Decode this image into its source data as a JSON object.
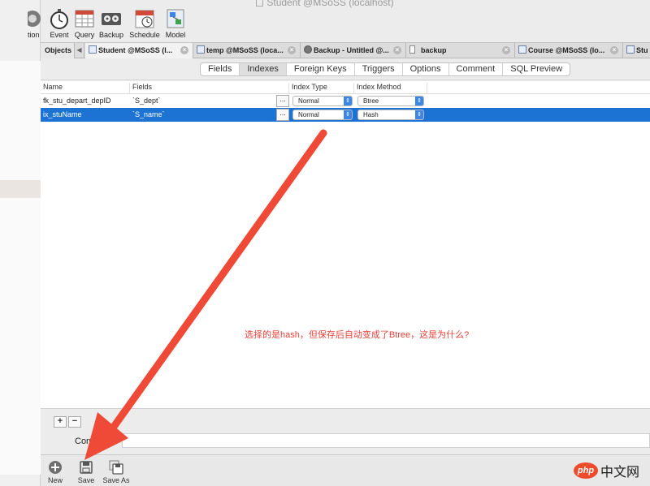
{
  "window": {
    "title": "Student @MSoSS (localhost)"
  },
  "toolbar": {
    "items": [
      {
        "label": "tion",
        "icon": "function-icon"
      },
      {
        "label": "Event",
        "icon": "stopwatch-icon"
      },
      {
        "label": "Query",
        "icon": "table-icon"
      },
      {
        "label": "Backup",
        "icon": "tape-icon"
      },
      {
        "label": "Schedule",
        "icon": "calendar-icon"
      },
      {
        "label": "Model",
        "icon": "model-icon"
      }
    ]
  },
  "tabs": {
    "objects": "Objects",
    "items": [
      {
        "label": "Student @MSoSS (l..."
      },
      {
        "label": "temp @MSoSS (loca..."
      },
      {
        "label": "Backup - Untitled @..."
      },
      {
        "label": "backup"
      },
      {
        "label": "Course @MSoSS (lo..."
      },
      {
        "label": "Stu"
      }
    ]
  },
  "subtabs": {
    "items": [
      "Fields",
      "Indexes",
      "Foreign Keys",
      "Triggers",
      "Options",
      "Comment",
      "SQL Preview"
    ],
    "active": "Indexes"
  },
  "grid": {
    "columns": [
      "Name",
      "Fields",
      "Index Type",
      "Index Method"
    ],
    "rows": [
      {
        "name": "fk_stu_depart_depID",
        "fields": "`S_dept`",
        "type": "Normal",
        "method": "Btree",
        "dots": "...",
        "selected": false
      },
      {
        "name": "ix_stuName",
        "fields": "`S_name`",
        "type": "Normal",
        "method": "Hash",
        "dots": "...",
        "selected": true
      }
    ]
  },
  "annotation": {
    "text": "选择的是hash，但保存后自动变成了Btree，这是为什么?",
    "color": "#e8413a"
  },
  "bottom": {
    "plus": "+",
    "minus": "−",
    "comment_label": "Comm",
    "buttons": [
      {
        "label": "New",
        "icon": "plus-circle-icon"
      },
      {
        "label": "Save",
        "icon": "save-icon"
      },
      {
        "label": "Save As",
        "icon": "save-as-icon"
      }
    ]
  },
  "watermark": {
    "logo": "php",
    "text": "中文网"
  },
  "colors": {
    "selection": "#1d73d4",
    "arrow": "#ef4a37"
  }
}
